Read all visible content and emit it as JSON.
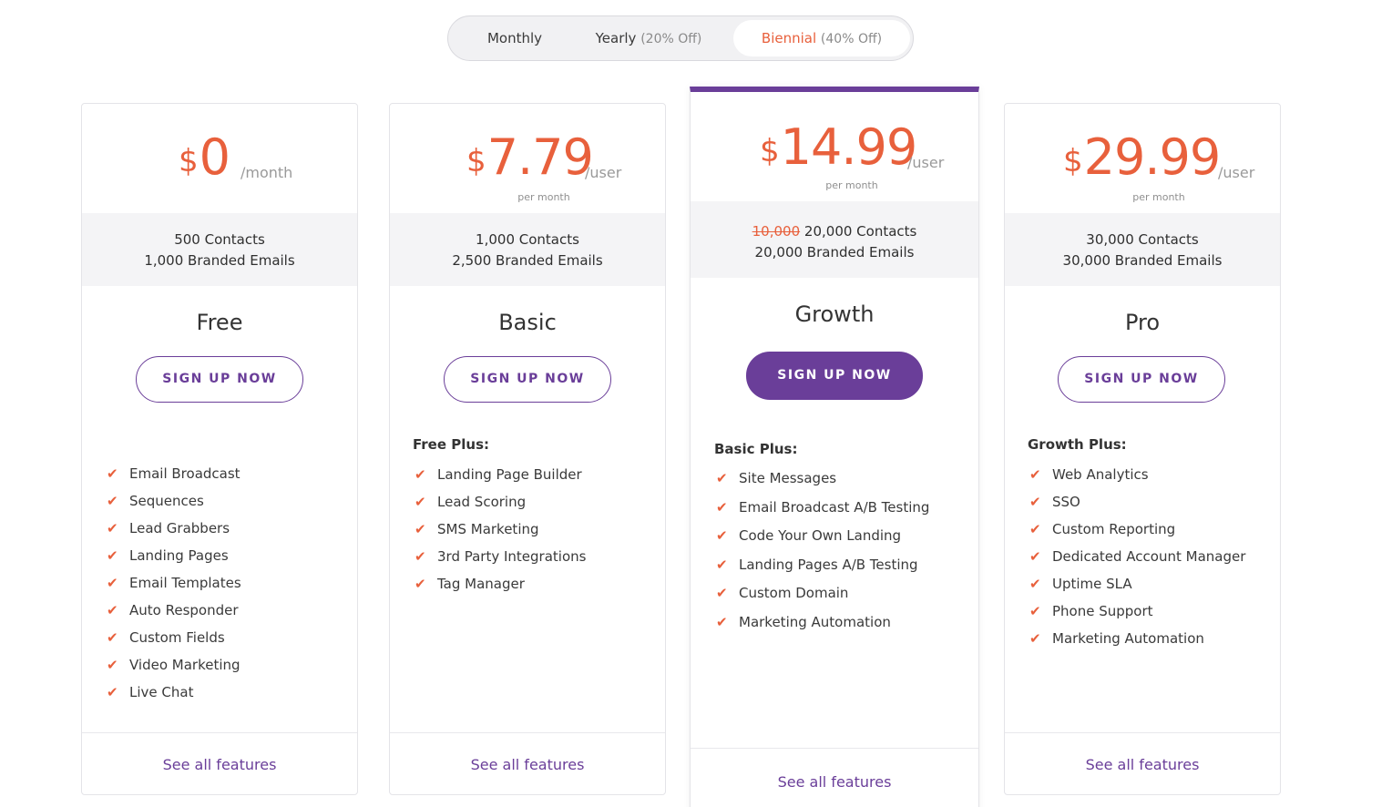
{
  "billing": {
    "monthly": "Monthly",
    "yearly": "Yearly",
    "yearly_discount": "(20% Off)",
    "biennial": "Biennial",
    "biennial_discount": "(40% Off)"
  },
  "colors": {
    "accent": "#e8603c",
    "brand": "#6a3e99"
  },
  "icons": {
    "feature_check": "check-icon"
  },
  "plans": [
    {
      "name": "Free",
      "currency": "$",
      "price": "0",
      "unit": "/month",
      "per": "",
      "contacts": "500 Contacts",
      "emails": "1,000 Branded Emails",
      "cta": "SIGN UP NOW",
      "features_heading": "",
      "features": [
        "Email Broadcast",
        "Sequences",
        "Lead Grabbers",
        "Landing Pages",
        "Email Templates",
        "Auto Responder",
        "Custom Fields",
        "Video Marketing",
        "Live Chat"
      ],
      "see_all": "See all features"
    },
    {
      "name": "Basic",
      "currency": "$",
      "price": "7.79",
      "unit": "/user",
      "per": "per month",
      "contacts": "1,000 Contacts",
      "emails": "2,500 Branded Emails",
      "cta": "SIGN UP NOW",
      "features_heading": "Free Plus:",
      "features": [
        "Landing Page Builder",
        "Lead Scoring",
        "SMS Marketing",
        "3rd Party Integrations",
        "Tag Manager"
      ],
      "see_all": "See all features"
    },
    {
      "name": "Growth",
      "currency": "$",
      "price": "14.99",
      "unit": "/user",
      "per": "per month",
      "contacts_old": "10,000",
      "contacts": "20,000 Contacts",
      "emails": "20,000 Branded Emails",
      "cta": "SIGN UP NOW",
      "features_heading": "Basic Plus:",
      "features": [
        "Site Messages",
        "Email Broadcast A/B Testing",
        "Code Your Own Landing",
        "Landing Pages A/B Testing",
        "Custom Domain",
        "Marketing Automation"
      ],
      "see_all": "See all features"
    },
    {
      "name": "Pro",
      "currency": "$",
      "price": "29.99",
      "unit": "/user",
      "per": "per month",
      "contacts": "30,000 Contacts",
      "emails": "30,000 Branded Emails",
      "cta": "SIGN UP NOW",
      "features_heading": "Growth Plus:",
      "features": [
        "Web Analytics",
        "SSO",
        "Custom Reporting",
        "Dedicated Account Manager",
        "Uptime SLA",
        "Phone Support",
        "Marketing Automation"
      ],
      "see_all": "See all features"
    }
  ]
}
